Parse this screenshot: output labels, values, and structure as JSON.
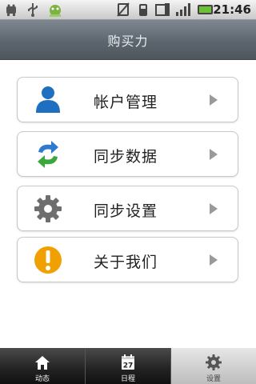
{
  "status_bar": {
    "time": "21:46",
    "icons": [
      "usb-debug-icon",
      "usb-icon",
      "android-icon",
      "no-sim-icon",
      "wifi-icon",
      "signal-box-icon",
      "signal-icon",
      "battery-icon"
    ]
  },
  "header": {
    "title": "购买力"
  },
  "menu": {
    "items": [
      {
        "label": "帐户管理",
        "icon": "user-icon"
      },
      {
        "label": "同步数据",
        "icon": "sync-icon"
      },
      {
        "label": "同步设置",
        "icon": "gear-icon"
      },
      {
        "label": "关于我们",
        "icon": "info-icon"
      }
    ]
  },
  "tabs": [
    {
      "label": "动态",
      "icon": "home-icon"
    },
    {
      "label": "日程",
      "icon": "calendar-icon",
      "calendar_day": "27"
    },
    {
      "label": "设置",
      "icon": "gear-icon"
    }
  ],
  "colors": {
    "title_bar": "#5d666e",
    "user_icon": "#1f6fc0",
    "sync_blue": "#2f7ad1",
    "sync_green": "#3aa83a",
    "info_orange": "#f0a000"
  }
}
